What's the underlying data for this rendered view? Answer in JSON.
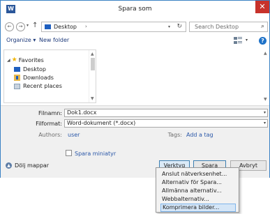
{
  "window": {
    "title": "Spara som",
    "app_icon_letter": "W",
    "close_glyph": "✕"
  },
  "nav": {
    "back_glyph": "←",
    "forward_glyph": "→",
    "up_glyph": "↑",
    "address": "Desktop",
    "address_sep": "›",
    "refresh_glyph": "↻",
    "search_placeholder": "Search Desktop",
    "search_glyph": "⌕"
  },
  "toolbar": {
    "organize": "Organize ▾",
    "new_folder": "New folder",
    "help_glyph": "?"
  },
  "navpane": {
    "favorites": "Favorites",
    "items": [
      "Desktop",
      "Downloads",
      "Recent places"
    ]
  },
  "form": {
    "filename_label": "Filnamn:",
    "filename_value": "Dok1.docx",
    "format_label": "Filformat:",
    "format_value": "Word-dokument (*.docx)",
    "authors_label": "Authors:",
    "authors_value": "user",
    "tags_label": "Tags:",
    "tags_value": "Add a tag",
    "thumbnail_label": "Spara miniatyr",
    "hide_folders": "Dölj mappar"
  },
  "buttons": {
    "tools": "Verktyg",
    "tools_dd": "▾",
    "save": "Spara",
    "cancel": "Avbryt"
  },
  "menu": {
    "items": [
      "Anslut nätverksenhet...",
      "Alternativ för Spara...",
      "Allmänna alternativ...",
      "Webbalternativ...",
      "Komprimera bilder..."
    ],
    "selected_index": 4
  },
  "colors": {
    "accent": "#3b82c4",
    "close_red": "#c7322b",
    "link_blue": "#2a57a8"
  }
}
